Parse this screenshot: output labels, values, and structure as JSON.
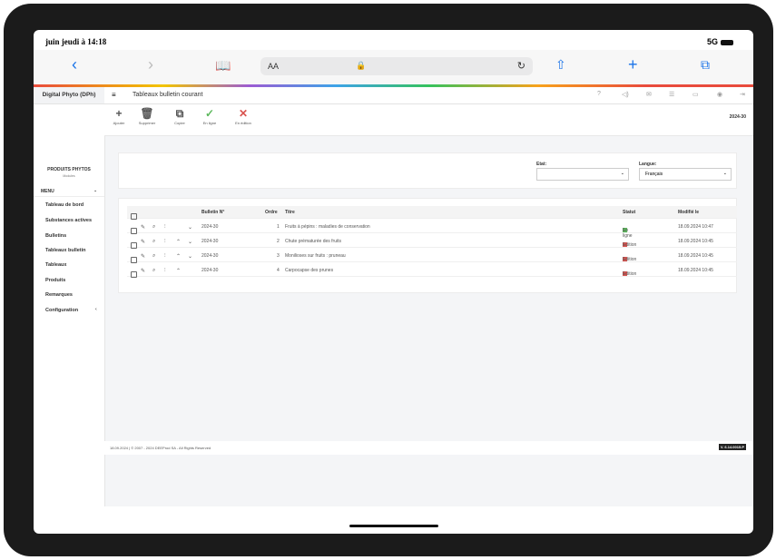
{
  "status_bar": {
    "time": "juin jeudi à 14:18",
    "network": "5G"
  },
  "safari": {
    "text_size": "AA"
  },
  "app": {
    "brand": "Digital Phyto (DPh)",
    "page_title": "Tableaux bulletin courant",
    "badge": "2024-30",
    "toolbar": [
      {
        "icon": "+",
        "label": "Ajouter"
      },
      {
        "icon": "🗑",
        "label": "Supprimer"
      },
      {
        "icon": "⧉",
        "label": "Copier"
      },
      {
        "icon": "✓",
        "label": "En ligne"
      },
      {
        "icon": "✕",
        "label": "En édition"
      }
    ],
    "sidebar": {
      "section_title": "PRODUITS PHYTOS",
      "section_sub": "Modules",
      "menu_label": "MENU",
      "items": [
        "Tableau de bord",
        "Substances actives",
        "Bulletins",
        "Tableaux bulletin",
        "Tableaux",
        "Produits",
        "Remarques",
        "Configuration"
      ]
    },
    "filters": {
      "etat_label": "Etat:",
      "etat_value": "",
      "langue_label": "Langue:",
      "langue_value": "Français"
    },
    "table": {
      "headers": [
        "Bulletin N°",
        "Ordre",
        "Titre",
        "Statut",
        "Modifié le"
      ],
      "rows": [
        {
          "bulletin": "2024-30",
          "ordre": "1",
          "titre": "Fruits à pépins : maladies de conservation",
          "statut": "En ligne",
          "modifie": "18.09.2024 10:47"
        },
        {
          "bulletin": "2024-30",
          "ordre": "2",
          "titre": "Chute prématurée des fruits",
          "statut": "Edition",
          "modifie": "18.09.2024 10:45"
        },
        {
          "bulletin": "2024-30",
          "ordre": "3",
          "titre": "Monilioses sur fruits : pruneau",
          "statut": "Edition",
          "modifie": "18.09.2024 10:45"
        },
        {
          "bulletin": "2024-30",
          "ordre": "4",
          "titre": "Carpocapse des prunes",
          "statut": "Edition",
          "modifie": "18.09.2024 10:45"
        }
      ]
    },
    "footer": {
      "text": "18.09.2024 | © 2007 - 2024 DEEProd SA - All Rights Reserved",
      "version": "V. 6.14.0015.P"
    },
    "colors": {
      "online": "#5cb85c",
      "edition": "#d9534f",
      "accent": "#1a73e8"
    }
  }
}
